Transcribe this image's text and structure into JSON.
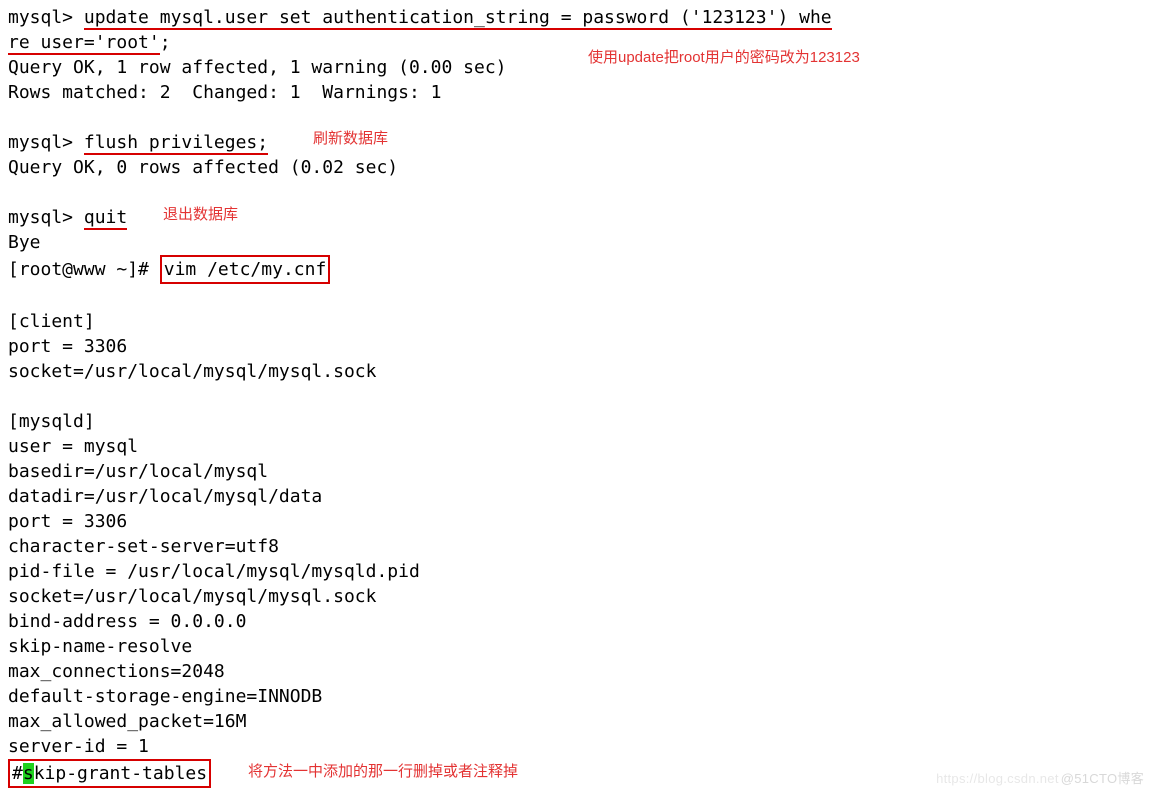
{
  "term": {
    "prompt_mysql": "mysql>",
    "prompt_root": "[root@www ~]#",
    "cmd_update_part1": "update mysql.user set authentication_string = password ('123123') whe",
    "cmd_update_part2a": "re user='root'",
    "cmd_update_part2b": ";",
    "resp_update_1": "Query OK, 1 row affected, 1 warning (0.00 sec)",
    "resp_update_2": "Rows matched: 2  Changed: 1  Warnings: 1",
    "cmd_flush": "flush privileges;",
    "resp_flush": "Query OK, 0 rows affected (0.02 sec)",
    "cmd_quit": "quit",
    "resp_quit": "Bye",
    "cmd_vim": "vim /etc/my.cnf",
    "cfg": [
      "[client]",
      "port = 3306",
      "socket=/usr/local/mysql/mysql.sock",
      "",
      "[mysqld]",
      "user = mysql",
      "basedir=/usr/local/mysql",
      "datadir=/usr/local/mysql/data",
      "port = 3306",
      "character-set-server=utf8",
      "pid-file = /usr/local/mysql/mysqld.pid",
      "socket=/usr/local/mysql/mysql.sock",
      "bind-address = 0.0.0.0",
      "skip-name-resolve",
      "max_connections=2048",
      "default-storage-engine=INNODB",
      "max_allowed_packet=16M",
      "server-id = 1"
    ],
    "cfg_last_hash": "#",
    "cfg_last_cursor": "s",
    "cfg_last_rest": "kip-grant-tables"
  },
  "notes": {
    "update": "使用update把root用户的密码改为123123",
    "flush": "刷新数据库",
    "quit": "退出数据库",
    "skip": "将方法一中添加的那一行删掉或者注释掉"
  },
  "watermark": {
    "a": "https://blog.csdn.net",
    "b": "@51CTO博客"
  }
}
